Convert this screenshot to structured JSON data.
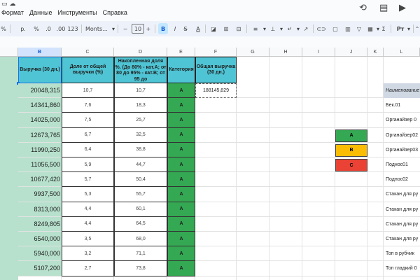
{
  "menu": [
    "Формат",
    "Данные",
    "Инструменты",
    "Справка"
  ],
  "toolbar": {
    "zoom": "%",
    "currency": "р.",
    "percent": "%",
    "dec_decrease": ".0",
    "dec_increase": ".00",
    "number_format": "123",
    "font": "Monts...",
    "font_size": "10",
    "bold": "B",
    "italic": "I",
    "strike": "S",
    "text_color": "A",
    "sigma": "Σ",
    "input_tool": "Рт"
  },
  "columns": [
    "B",
    "C",
    "D",
    "E",
    "F",
    "G",
    "H",
    "I",
    "J",
    "K",
    "L"
  ],
  "selected_column": "B",
  "headers": {
    "b": "Выручка (30 дн.)",
    "c": "Доле от общей выручки (%)",
    "d": "Накопленная доля %. (До 80% - кат.А; от 80 до 95% - кат.В; от 95 до",
    "e": "Категория",
    "f": "Общая выручка (30 дн.)"
  },
  "rows": [
    {
      "b": "20048,315",
      "c": "10,7",
      "d": "10,7",
      "e": "A",
      "f": "188145,829",
      "l": "Наименование"
    },
    {
      "b": "14341,860",
      "c": "7,6",
      "d": "18,3",
      "e": "A",
      "f": "",
      "l": "Бек.01"
    },
    {
      "b": "14025,000",
      "c": "7,5",
      "d": "25,7",
      "e": "A",
      "f": "",
      "l": "Органайзер 0"
    },
    {
      "b": "12673,765",
      "c": "6,7",
      "d": "32,5",
      "e": "A",
      "f": "",
      "l": "Органайзер02"
    },
    {
      "b": "11990,250",
      "c": "6,4",
      "d": "38,8",
      "e": "A",
      "f": "",
      "l": "Органайзер03"
    },
    {
      "b": "11056,500",
      "c": "5,9",
      "d": "44,7",
      "e": "A",
      "f": "",
      "l": "Поднос01"
    },
    {
      "b": "10677,420",
      "c": "5,7",
      "d": "50,4",
      "e": "A",
      "f": "",
      "l": "Поднос02"
    },
    {
      "b": "9937,500",
      "c": "5,3",
      "d": "55,7",
      "e": "A",
      "f": "",
      "l": "Стакан для ру"
    },
    {
      "b": "8313,000",
      "c": "4,4",
      "d": "60,1",
      "e": "A",
      "f": "",
      "l": "Стакан для ру"
    },
    {
      "b": "8249,805",
      "c": "4,4",
      "d": "64,5",
      "e": "A",
      "f": "",
      "l": "Стакан для ру"
    },
    {
      "b": "6540,000",
      "c": "3,5",
      "d": "68,0",
      "e": "A",
      "f": "",
      "l": "Стакан для ру"
    },
    {
      "b": "5940,000",
      "c": "3,2",
      "d": "71,1",
      "e": "A",
      "f": "",
      "l": "Топ в рубчик"
    },
    {
      "b": "5107,200",
      "c": "2,7",
      "d": "73,8",
      "e": "A",
      "f": "",
      "l": "Топ гладкий 0"
    }
  ],
  "legend": [
    {
      "label": "A",
      "color": "#34a853"
    },
    {
      "label": "B",
      "color": "#fbbc04"
    },
    {
      "label": "C",
      "color": "#ea4335"
    }
  ]
}
